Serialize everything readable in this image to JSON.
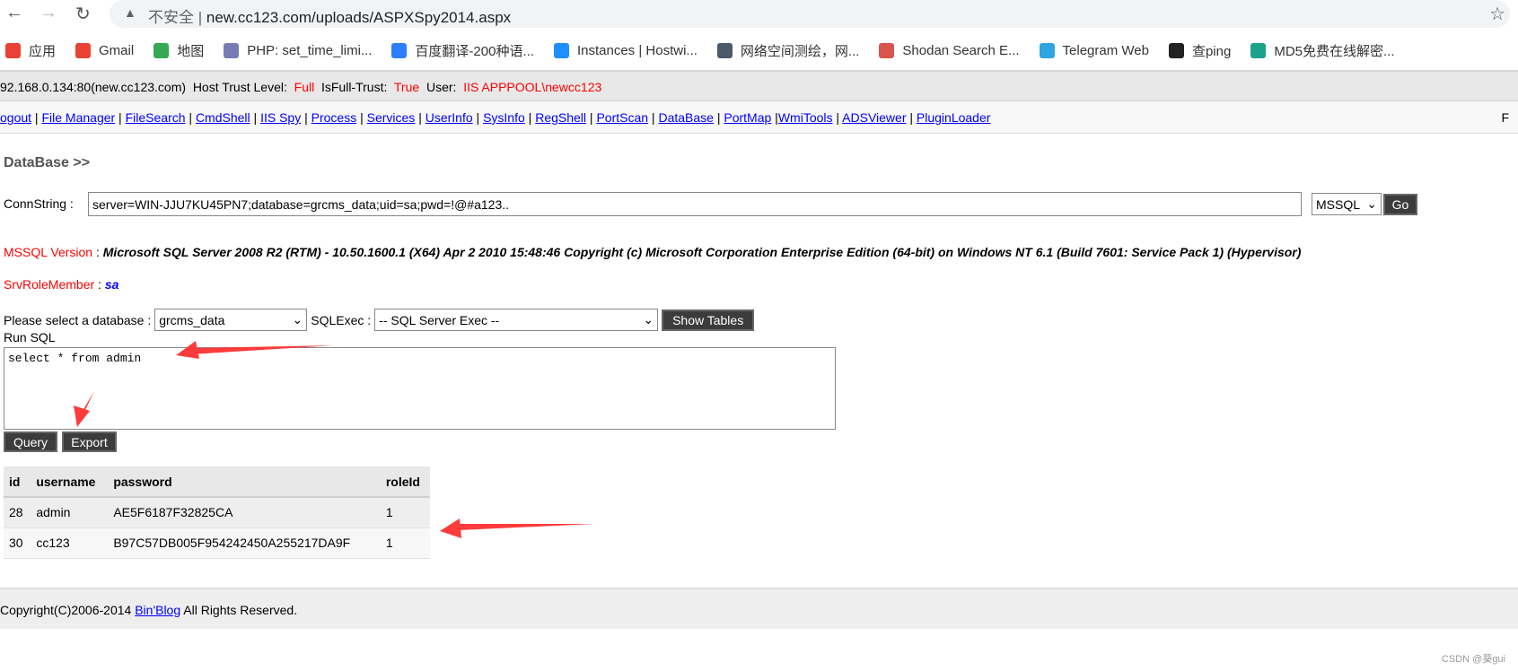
{
  "browser": {
    "back_icon": "arrow-left",
    "forward_icon": "arrow-right",
    "reload_icon": "reload",
    "insecure_label": "不安全",
    "url": "new.cc123.com/uploads/ASPXSpy2014.aspx",
    "bookmark_icon": "star"
  },
  "bookmarks": [
    {
      "label": "应用",
      "icon": "apps-grid",
      "color": "#e94235"
    },
    {
      "label": "Gmail",
      "icon": "gmail",
      "color": "#ea4335"
    },
    {
      "label": "地图",
      "icon": "maps-pin",
      "color": "#34a853"
    },
    {
      "label": "PHP: set_time_limi...",
      "icon": "php",
      "color": "#777bb3"
    },
    {
      "label": "百度翻译-200种语...",
      "icon": "baidu-translate",
      "color": "#2b7fff"
    },
    {
      "label": "Instances | Hostwi...",
      "icon": "hostwinds",
      "color": "#1e90ff"
    },
    {
      "label": "网络空间测绘，网...",
      "icon": "fofa",
      "color": "#4a5a6a"
    },
    {
      "label": "Shodan Search E...",
      "icon": "shodan",
      "color": "#d9534f"
    },
    {
      "label": "Telegram Web",
      "icon": "telegram",
      "color": "#2ca5e0"
    },
    {
      "label": "查ping",
      "icon": "ping",
      "color": "#222222"
    },
    {
      "label": "MD5免费在线解密...",
      "icon": "md5",
      "color": "#1aa38a"
    }
  ],
  "info": {
    "host": "92.168.0.134:80(new.cc123.com)",
    "trust_label": "Host Trust Level:",
    "trust_value": "Full",
    "fulltrust_label": "IsFull-Trust:",
    "fulltrust_value": "True",
    "user_label": "User:",
    "user_value": "IIS APPPOOL\\newcc123"
  },
  "nav": [
    "ogout",
    "File Manager",
    "FileSearch",
    "CmdShell",
    "IIS Spy",
    "Process",
    "Services",
    "UserInfo",
    "SysInfo",
    "RegShell",
    "PortScan",
    "DataBase",
    "PortMap",
    "WmiTools",
    "ADSViewer",
    "PluginLoader"
  ],
  "nav_right": "F",
  "page": {
    "title": "DataBase >>",
    "conn_label": "ConnString :",
    "conn_value": "server=WIN-JJU7KU45PN7;database=grcms_data;uid=sa;pwd=!@#a123..",
    "db_type": "MSSQL",
    "go_label": "Go",
    "version_label": "MSSQL Version",
    "version_value": "Microsoft SQL Server 2008 R2 (RTM) - 10.50.1600.1 (X64) Apr 2 2010 15:48:46 Copyright (c) Microsoft Corporation Enterprise Edition (64-bit) on Windows NT 6.1 (Build 7601: Service Pack 1) (Hypervisor)",
    "role_label": "SrvRoleMember",
    "role_value": "sa",
    "db_select_label": "Please select a database :",
    "db_selected": "grcms_data",
    "sqlexec_label": "SQLExec :",
    "sqlexec_selected": "-- SQL Server Exec --",
    "show_tables_label": "Show Tables",
    "run_sql_label": "Run SQL",
    "sql_value": "select * from admin",
    "query_label": "Query",
    "export_label": "Export"
  },
  "results": {
    "columns": [
      "id",
      "username",
      "password",
      "roleId"
    ],
    "rows": [
      [
        "28",
        "admin",
        "AE5F6187F32825CA",
        "1"
      ],
      [
        "30",
        "cc123",
        "B97C57DB005F954242450A255217DA9F",
        "1"
      ]
    ]
  },
  "footer": {
    "prefix": "Copyright(C)2006-2014 ",
    "link": "Bin'Blog",
    "suffix": " All Rights Reserved."
  },
  "watermark": "CSDN @葵gui",
  "annotation_color": "#ff3b3b"
}
